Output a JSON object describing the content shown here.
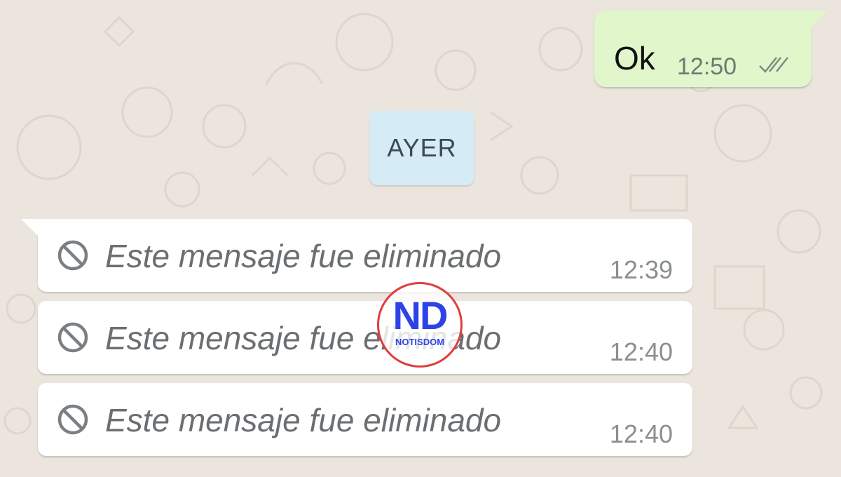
{
  "conversation": {
    "outgoing": {
      "text": "Ok",
      "time": "12:50",
      "status_icon": "double-check-icon"
    },
    "date_separator": "AYER",
    "incoming": [
      {
        "icon": "block-icon",
        "text": "Este mensaje fue eliminado",
        "time": "12:39"
      },
      {
        "icon": "block-icon",
        "text": "Este mensaje fue eliminado",
        "time": "12:40"
      },
      {
        "icon": "block-icon",
        "text": "Este mensaje fue eliminado",
        "time": "12:40"
      }
    ]
  },
  "watermark": {
    "mark": "ND",
    "name": "NOTISDOM"
  },
  "colors": {
    "background": "#ebe5dd",
    "outgoing_bubble": "#e1f7cb",
    "incoming_bubble": "#ffffff",
    "date_chip": "#d5ebf6",
    "logo_blue": "#2e43e6",
    "logo_red": "#e03d3d"
  }
}
